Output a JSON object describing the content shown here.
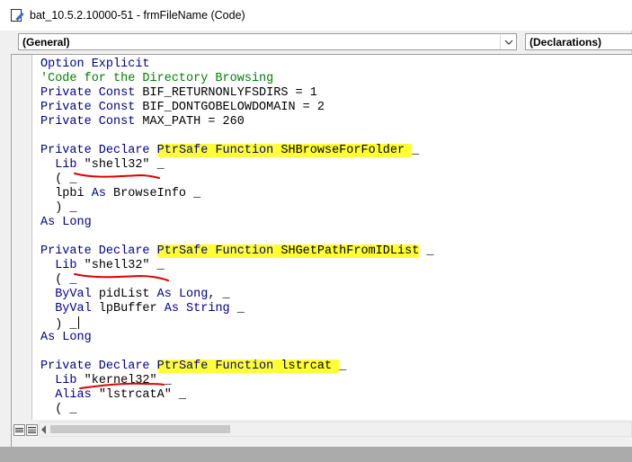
{
  "window": {
    "title": "bat_10.5.2.10000-51 - frmFileName (Code)",
    "icon": "code-window-icon"
  },
  "object_combo": {
    "value": "(General)"
  },
  "procedure_combo": {
    "value": "(Declarations)"
  },
  "code": {
    "lines": [
      [
        {
          "t": "Option Explicit",
          "c": "kw"
        }
      ],
      [
        {
          "t": "'Code for the Directory Browsing",
          "c": "cm"
        }
      ],
      [
        {
          "t": "Private Const",
          "c": "kw"
        },
        {
          "t": " BIF_RETURNONLYFSDIRS = 1"
        }
      ],
      [
        {
          "t": "Private Const",
          "c": "kw"
        },
        {
          "t": " BIF_DONTGOBELOWDOMAIN = 2"
        }
      ],
      [
        {
          "t": "Private Const",
          "c": "kw"
        },
        {
          "t": " MAX_PATH = 260"
        }
      ],
      [],
      [
        {
          "t": "Private Declare",
          "c": "kw"
        },
        {
          "t": " "
        },
        {
          "t": "PtrSafe Function",
          "c": "kw hl"
        },
        {
          "t": " SHBrowseForFolder ",
          "c": "hl"
        },
        {
          "t": "_"
        }
      ],
      [
        {
          "t": "  "
        },
        {
          "t": "Lib",
          "c": "kw"
        },
        {
          "t": " \"shell32\" _"
        }
      ],
      [
        {
          "t": "  ( _"
        }
      ],
      [
        {
          "t": "  lpbi "
        },
        {
          "t": "As",
          "c": "kw"
        },
        {
          "t": " BrowseInfo _"
        }
      ],
      [
        {
          "t": "  ) _"
        }
      ],
      [
        {
          "t": "As Long",
          "c": "kw"
        }
      ],
      [],
      [
        {
          "t": "Private Declare",
          "c": "kw"
        },
        {
          "t": " "
        },
        {
          "t": "PtrSafe Function",
          "c": "kw hl"
        },
        {
          "t": " SHGetPathFromIDList",
          "c": "hl"
        },
        {
          "t": " _"
        }
      ],
      [
        {
          "t": "  "
        },
        {
          "t": "Lib",
          "c": "kw"
        },
        {
          "t": " \"shell32\" _"
        }
      ],
      [
        {
          "t": "  ( _"
        }
      ],
      [
        {
          "t": "  "
        },
        {
          "t": "ByVal",
          "c": "kw"
        },
        {
          "t": " pidList "
        },
        {
          "t": "As Long",
          "c": "kw"
        },
        {
          "t": ", _"
        }
      ],
      [
        {
          "t": "  "
        },
        {
          "t": "ByVal",
          "c": "kw"
        },
        {
          "t": " lpBuffer "
        },
        {
          "t": "As String",
          "c": "kw"
        },
        {
          "t": " _"
        }
      ],
      [
        {
          "t": "  ) _",
          "caret": true
        }
      ],
      [
        {
          "t": "As Long",
          "c": "kw"
        }
      ],
      [],
      [
        {
          "t": "Private Declare",
          "c": "kw"
        },
        {
          "t": " "
        },
        {
          "t": "PtrSafe Function",
          "c": "kw hl"
        },
        {
          "t": " lstrcat ",
          "c": "hl"
        },
        {
          "t": "_"
        }
      ],
      [
        {
          "t": "  "
        },
        {
          "t": "Lib",
          "c": "kw"
        },
        {
          "t": " \"kernel32\" _"
        }
      ],
      [
        {
          "t": "  "
        },
        {
          "t": "Alias",
          "c": "kw"
        },
        {
          "t": " \"lstrcatA\" _"
        }
      ],
      [
        {
          "t": "  ( _"
        }
      ]
    ]
  },
  "bottom_bar": {
    "procedure_view_icon": "procedure-view-icon",
    "full_module_view_icon": "full-module-view-icon"
  },
  "colors": {
    "keyword": "#00008b",
    "comment": "#008000",
    "highlight": "#ffff33",
    "underline": "#e00000"
  }
}
